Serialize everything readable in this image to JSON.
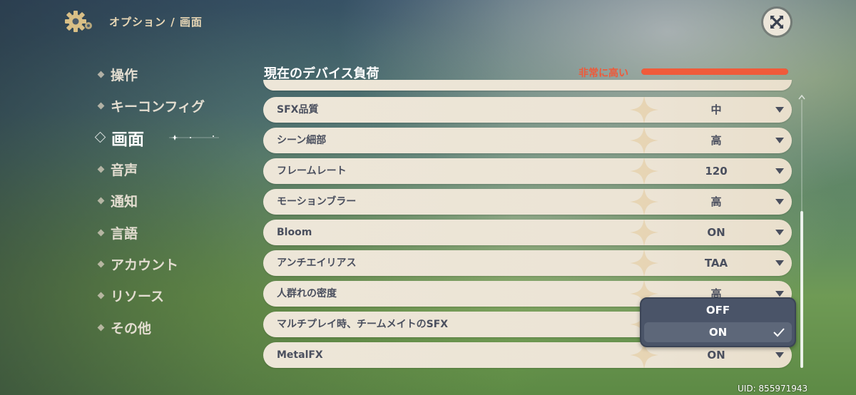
{
  "header": {
    "breadcrumb": "オプション / 画面",
    "icons": {
      "settings": "gear-icon",
      "close": "close-icon"
    }
  },
  "sidebar": {
    "items": [
      {
        "label": "操作",
        "active": false
      },
      {
        "label": "キーコンフィグ",
        "active": false
      },
      {
        "label": "画面",
        "active": true
      },
      {
        "label": "音声",
        "active": false
      },
      {
        "label": "通知",
        "active": false
      },
      {
        "label": "言語",
        "active": false
      },
      {
        "label": "アカウント",
        "active": false
      },
      {
        "label": "リソース",
        "active": false
      },
      {
        "label": "その他",
        "active": false
      }
    ]
  },
  "device_load": {
    "title": "現在のデバイス負荷",
    "value_label": "非常に高い",
    "fill_percent": 100,
    "color": "#f05b3a"
  },
  "settings": [
    {
      "label": "SFX品質",
      "value": "中"
    },
    {
      "label": "シーン細部",
      "value": "高"
    },
    {
      "label": "フレームレート",
      "value": "120"
    },
    {
      "label": "モーションブラー",
      "value": "高"
    },
    {
      "label": "Bloom",
      "value": "ON"
    },
    {
      "label": "アンチエイリアス",
      "value": "TAA"
    },
    {
      "label": "人群れの密度",
      "value": "高"
    },
    {
      "label": "マルチプレイ時、チームメイトのSFX",
      "value": ""
    },
    {
      "label": "MetalFX",
      "value": "ON"
    }
  ],
  "dropdown": {
    "options": [
      "OFF",
      "ON"
    ],
    "selected": "ON"
  },
  "uid": "UID: 855971943"
}
